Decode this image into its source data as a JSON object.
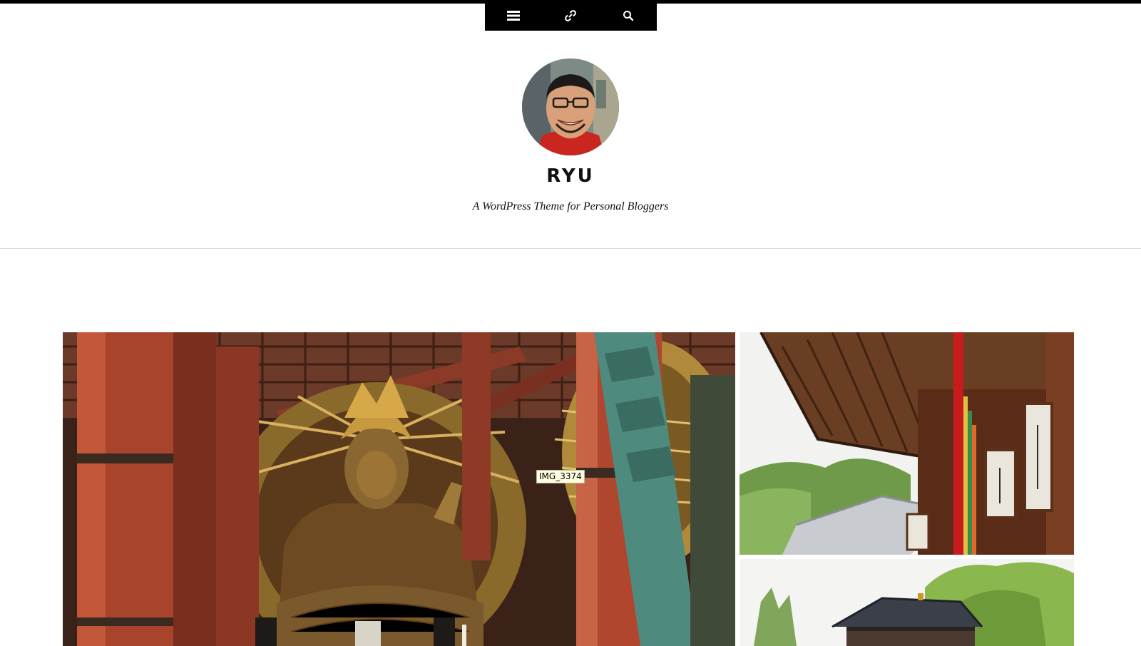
{
  "toolbar": {
    "buttons": [
      {
        "icon": "menu-icon"
      },
      {
        "icon": "link-icon"
      },
      {
        "icon": "search-icon"
      }
    ]
  },
  "header": {
    "avatar_icon": "author-avatar",
    "title": "RYU",
    "description": "A WordPress Theme for Personal Bloggers"
  },
  "gallery": {
    "tooltip": "IMG_3374"
  },
  "colors": {
    "toolbar_bg": "#000000",
    "divider": "#dcdcdc",
    "text": "#111111"
  }
}
